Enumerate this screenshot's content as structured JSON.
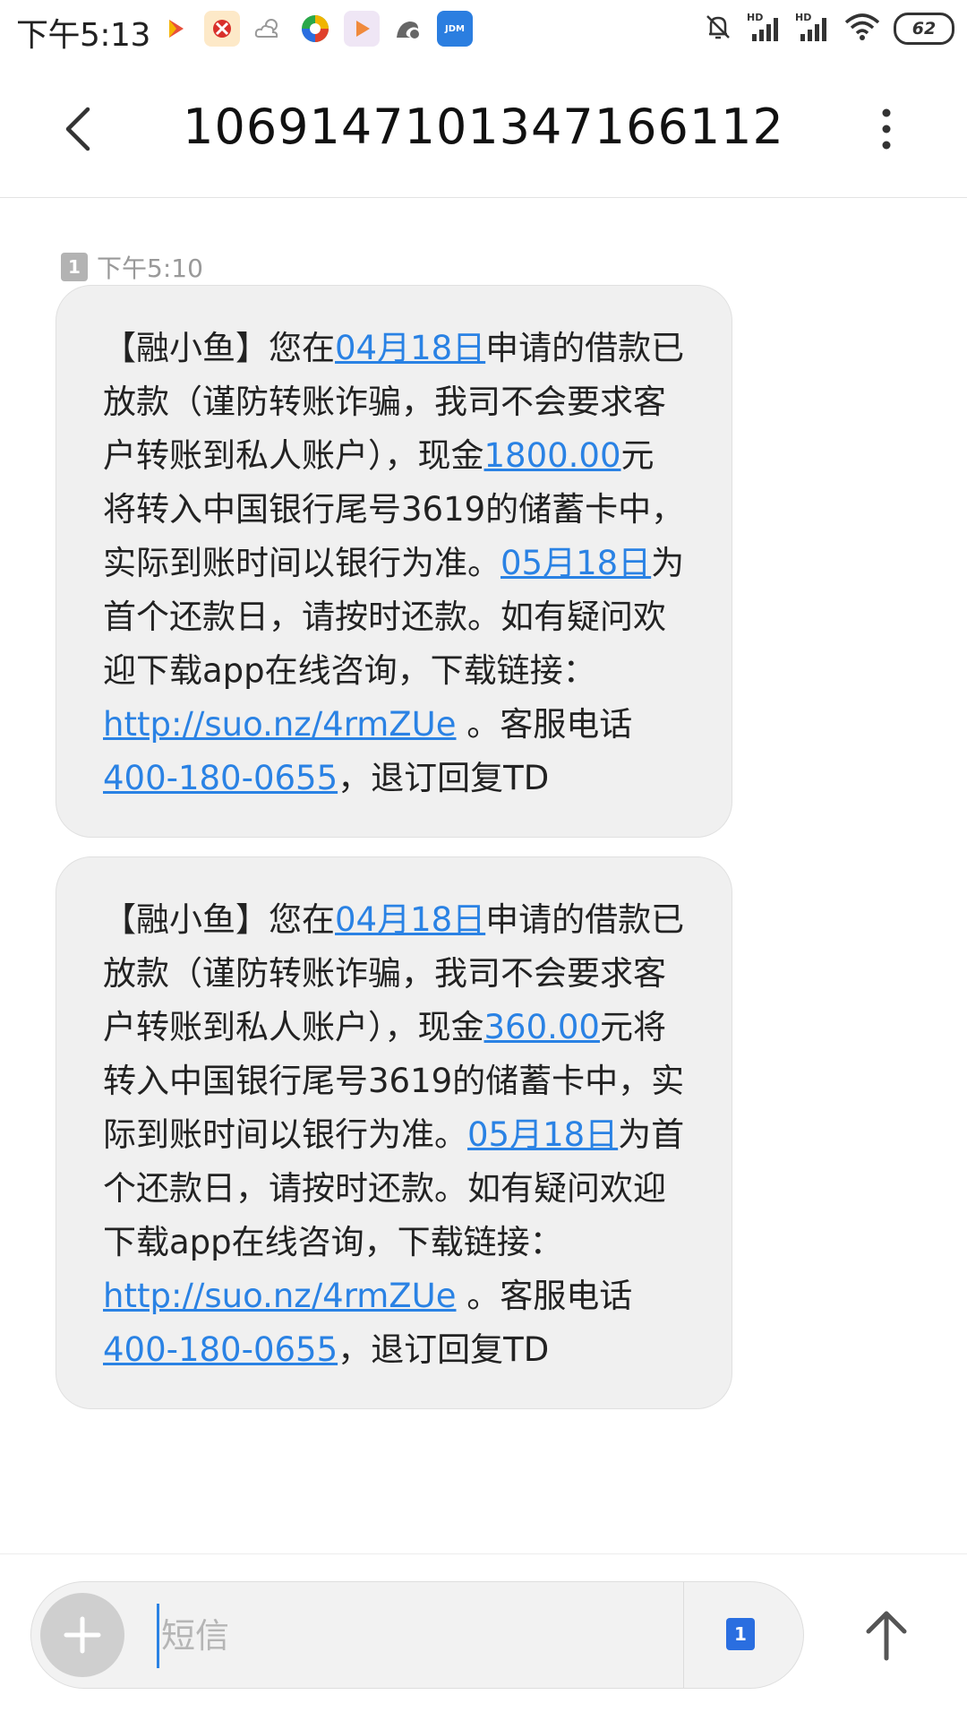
{
  "status_bar": {
    "time": "下午5:13",
    "battery": "62",
    "notification_icons": [
      "video-play-icon",
      "app-red-icon",
      "weather-cloud-icon",
      "app-colorful-icon",
      "video-app-icon",
      "uc-browser-icon",
      "jdm-app-icon"
    ],
    "jdm_label": "JDM",
    "system_icons": [
      "mute-bell-icon",
      "hd-signal-icon",
      "hd-signal-icon",
      "wifi-icon",
      "battery-icon"
    ]
  },
  "header": {
    "title": "1069147101347166112"
  },
  "messages": {
    "timestamp": "下午5:10",
    "sim_label": "1",
    "items": [
      {
        "p1": "【融小鱼】您在",
        "date_link": "04月18日",
        "p2": "申请的借款已放款（谨防转账诈骗，我司不会要求客户转账到私人账户），现金",
        "amount_link": "1800.00",
        "p3": "元将转入中国银行尾号3619的储蓄卡中，实际到账时间以银行为准。",
        "due_link": "05月18日",
        "p4": "为首个还款日，请按时还款。如有疑问欢迎下载app在线咨询，下载链接：",
        "url_link": "http://suo.nz/4rmZUe",
        "p5": " 。客服电话",
        "phone_link": "400-180-0655",
        "p6": "，退订回复TD"
      },
      {
        "p1": "【融小鱼】您在",
        "date_link": "04月18日",
        "p2": "申请的借款已放款（谨防转账诈骗，我司不会要求客户转账到私人账户），现金",
        "amount_link": "360.00",
        "p3": "元将转入中国银行尾号3619的储蓄卡中，实际到账时间以银行为准。",
        "due_link": "05月18日",
        "p4": "为首个还款日，请按时还款。如有疑问欢迎下载app在线咨询，下载链接：",
        "url_link": "http://suo.nz/4rmZUe",
        "p5": " 。客服电话",
        "phone_link": "400-180-0655",
        "p6": "，退订回复TD"
      }
    ]
  },
  "composer": {
    "placeholder": "短信",
    "value": "",
    "sim_label": "1"
  },
  "colors": {
    "link": "#2a82e4",
    "bubble_bg": "#f0f0f0",
    "sim_blue": "#2a6ee0"
  }
}
